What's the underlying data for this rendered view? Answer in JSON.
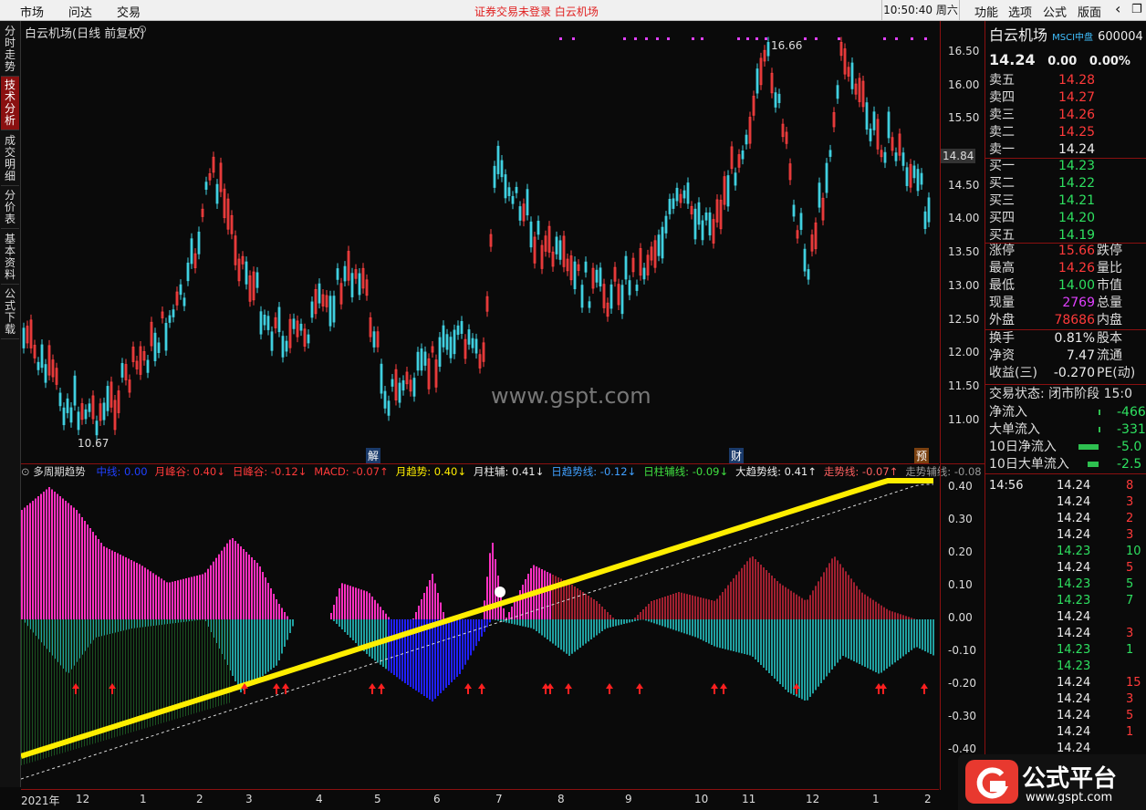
{
  "topbar": {
    "menus": [
      "市场",
      "问达",
      "交易"
    ],
    "notice": "证券交易未登录  白云机场",
    "clock": "10:50:40 周六",
    "right_menus": [
      "功能",
      "选项",
      "公式",
      "版面"
    ],
    "back_icon": "‹",
    "restore_icon": "❐"
  },
  "sidebar": {
    "tabs": [
      "分时走势",
      "技术分析",
      "成交明细",
      "分价表",
      "基本资料",
      "公式下载"
    ],
    "active": 1
  },
  "main_chart": {
    "title": "白云机场(日线 前复权)",
    "high_label": "16.66",
    "low_label": "10.67",
    "watermark": "www.gspt.com",
    "markers": [
      "解",
      "财",
      "预"
    ],
    "price_now": "14.84",
    "yticks": [
      "16.50",
      "16.00",
      "15.50",
      "15.00",
      "14.50",
      "14.00",
      "13.50",
      "13.00",
      "12.50",
      "12.00",
      "11.50",
      "11.00"
    ]
  },
  "indicator": {
    "title": "多周期趋势",
    "legend": [
      {
        "text": "中线: 0.00",
        "color": "#2040ff"
      },
      {
        "text": "月峰谷: 0.40↓",
        "color": "#ff3a3a"
      },
      {
        "text": "日峰谷: -0.12↓",
        "color": "#ff3a3a"
      },
      {
        "text": "MACD: -0.07↑",
        "color": "#ff3a3a"
      },
      {
        "text": "月趋势: 0.40↓",
        "color": "#ffee00"
      },
      {
        "text": "月柱辅: 0.41↓",
        "color": "#eeeeee"
      },
      {
        "text": "日趋势线: -0.12↓",
        "color": "#40a0ff"
      },
      {
        "text": "日柱辅线: -0.09↓",
        "color": "#40e040"
      },
      {
        "text": "大趋势线: 0.41↑",
        "color": "#eeeeee"
      },
      {
        "text": "走势线: -0.07↑",
        "color": "#ff6060"
      },
      {
        "text": "走势辅线: -0.08",
        "color": "#999999"
      }
    ],
    "yticks": [
      "0.40",
      "0.30",
      "0.20",
      "0.10",
      "0.00",
      "-0.10",
      "-0.20",
      "-0.30",
      "-0.40"
    ]
  },
  "xaxis": {
    "ticks": [
      "2021年",
      "12",
      "1",
      "2",
      "3",
      "4",
      "5",
      "6",
      "7",
      "8",
      "9",
      "10",
      "11",
      "12",
      "1",
      "2"
    ]
  },
  "quote": {
    "name": "白云机场",
    "index": "MSCI中盘",
    "code": "600004",
    "price": "14.24",
    "change": "0.00",
    "pct": "0.00%",
    "asks": [
      {
        "label": "卖五",
        "price": "14.28"
      },
      {
        "label": "卖四",
        "price": "14.27"
      },
      {
        "label": "卖三",
        "price": "14.26"
      },
      {
        "label": "卖二",
        "price": "14.25"
      },
      {
        "label": "卖一",
        "price": "14.24"
      }
    ],
    "bids": [
      {
        "label": "买一",
        "price": "14.23"
      },
      {
        "label": "买二",
        "price": "14.22"
      },
      {
        "label": "买三",
        "price": "14.21"
      },
      {
        "label": "买四",
        "price": "14.20"
      },
      {
        "label": "买五",
        "price": "14.19"
      }
    ],
    "stats": [
      {
        "k": "涨停",
        "v": "15.66",
        "k2": "跌停"
      },
      {
        "k": "最高",
        "v": "14.26",
        "k2": "量比"
      },
      {
        "k": "最低",
        "v": "14.00",
        "k2": "市值"
      },
      {
        "k": "现量",
        "v": "2769",
        "k2": "总量"
      },
      {
        "k": "外盘",
        "v": "78686",
        "k2": "内盘"
      }
    ],
    "stats2": [
      {
        "k": "换手",
        "v": "0.81%",
        "k2": "股本"
      },
      {
        "k": "净资",
        "v": "7.47",
        "k2": "流通"
      },
      {
        "k": "收益(三)",
        "v": "-0.270",
        "k2": "PE(动)"
      }
    ],
    "status_label": "交易状态: 闭市阶段 15:0",
    "flows": [
      {
        "k": "净流入",
        "v": "-466"
      },
      {
        "k": "大单流入",
        "v": "-331"
      },
      {
        "k": "10日净流入",
        "v": "-5.0"
      },
      {
        "k": "10日大单流入",
        "v": "-2.5"
      }
    ],
    "ticks": [
      {
        "t": "14:56",
        "p": "14.24",
        "v": "8"
      },
      {
        "t": "",
        "p": "14.24",
        "v": "3"
      },
      {
        "t": "",
        "p": "14.24",
        "v": "2"
      },
      {
        "t": "",
        "p": "14.24",
        "v": "3"
      },
      {
        "t": "",
        "p": "14.23",
        "v": "10"
      },
      {
        "t": "",
        "p": "14.24",
        "v": "5"
      },
      {
        "t": "",
        "p": "14.23",
        "v": "5"
      },
      {
        "t": "",
        "p": "14.23",
        "v": "7"
      },
      {
        "t": "",
        "p": "14.24",
        "v": ""
      },
      {
        "t": "",
        "p": "14.24",
        "v": "3"
      },
      {
        "t": "",
        "p": "14.23",
        "v": "1"
      },
      {
        "t": "",
        "p": "14.23",
        "v": ""
      },
      {
        "t": "",
        "p": "14.24",
        "v": "15"
      },
      {
        "t": "",
        "p": "14.24",
        "v": "3"
      },
      {
        "t": "",
        "p": "14.24",
        "v": "5"
      },
      {
        "t": "",
        "p": "14.24",
        "v": "1"
      },
      {
        "t": "",
        "p": "14.24",
        "v": ""
      }
    ]
  },
  "logo": {
    "text": "公式平台",
    "url": "www.gspt.com"
  }
}
